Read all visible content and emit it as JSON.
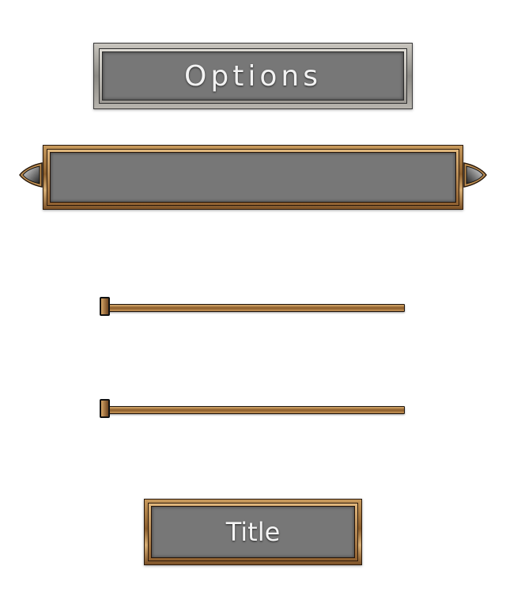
{
  "header": {
    "title": "Options"
  },
  "selector": {
    "value": "",
    "prev_icon": "arrow-left-icon",
    "next_icon": "arrow-right-icon"
  },
  "sliders": [
    {
      "value": 0.0
    },
    {
      "value": 0.0
    }
  ],
  "button": {
    "label": "Title"
  },
  "colors": {
    "background": "#ffffff",
    "panel_face": "#777777",
    "gold_frame": "#b8874a",
    "silver_frame": "#a9a6a0",
    "text": "#f2f2f2"
  }
}
